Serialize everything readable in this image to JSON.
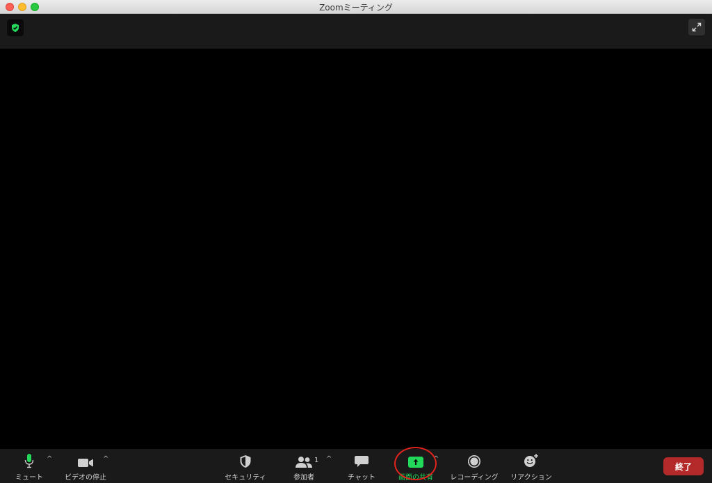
{
  "window": {
    "title": "Zoomミーティング"
  },
  "toolbar": {
    "mute_label": "ミュート",
    "video_label": "ビデオの停止",
    "security_label": "セキュリティ",
    "participants_label": "参加者",
    "participants_count": "1",
    "chat_label": "チャット",
    "share_label": "画面の共有",
    "record_label": "レコーディング",
    "reactions_label": "リアクション",
    "end_label": "終了",
    "caret": "^"
  },
  "icons": {
    "security_badge": "shield-check-icon",
    "fullscreen": "expand-icon",
    "mute": "microphone-icon",
    "video": "video-camera-icon",
    "security": "shield-icon",
    "participants": "people-icon",
    "chat": "chat-bubble-icon",
    "share": "share-screen-icon",
    "record": "record-icon",
    "reactions": "smiley-plus-icon"
  },
  "colors": {
    "accent_green": "#23d959",
    "end_red": "#b42a2a",
    "highlight_red": "#e3241d",
    "toolbar_bg": "#1a1a1a"
  }
}
